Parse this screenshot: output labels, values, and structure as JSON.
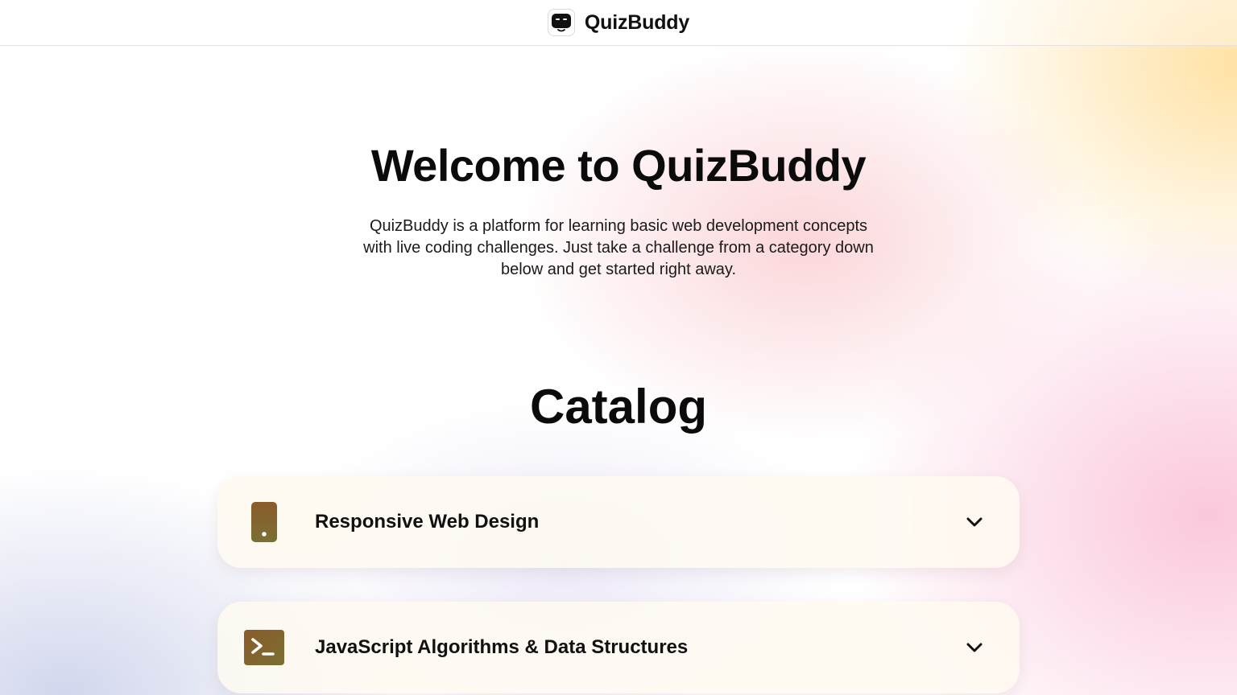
{
  "header": {
    "brand_name": "QuizBuddy",
    "logo_icon": "robot-face-icon"
  },
  "hero": {
    "title": "Welcome to QuizBuddy",
    "description": "QuizBuddy is a platform for learning basic web development concepts with live coding challenges. Just take a challenge from a category down below and get started right away."
  },
  "catalog": {
    "title": "Catalog",
    "items": [
      {
        "label": "Responsive Web Design",
        "icon": "mobile-phone-icon",
        "expand_icon": "chevron-down-icon"
      },
      {
        "label": "JavaScript Algorithms & Data Structures",
        "icon": "terminal-icon",
        "expand_icon": "chevron-down-icon"
      }
    ]
  },
  "colors": {
    "icon_gradient_start": "#8a5a2b",
    "icon_gradient_end": "#7a7032",
    "text": "#0b0b0b",
    "card_bg": "#fffaf0"
  }
}
